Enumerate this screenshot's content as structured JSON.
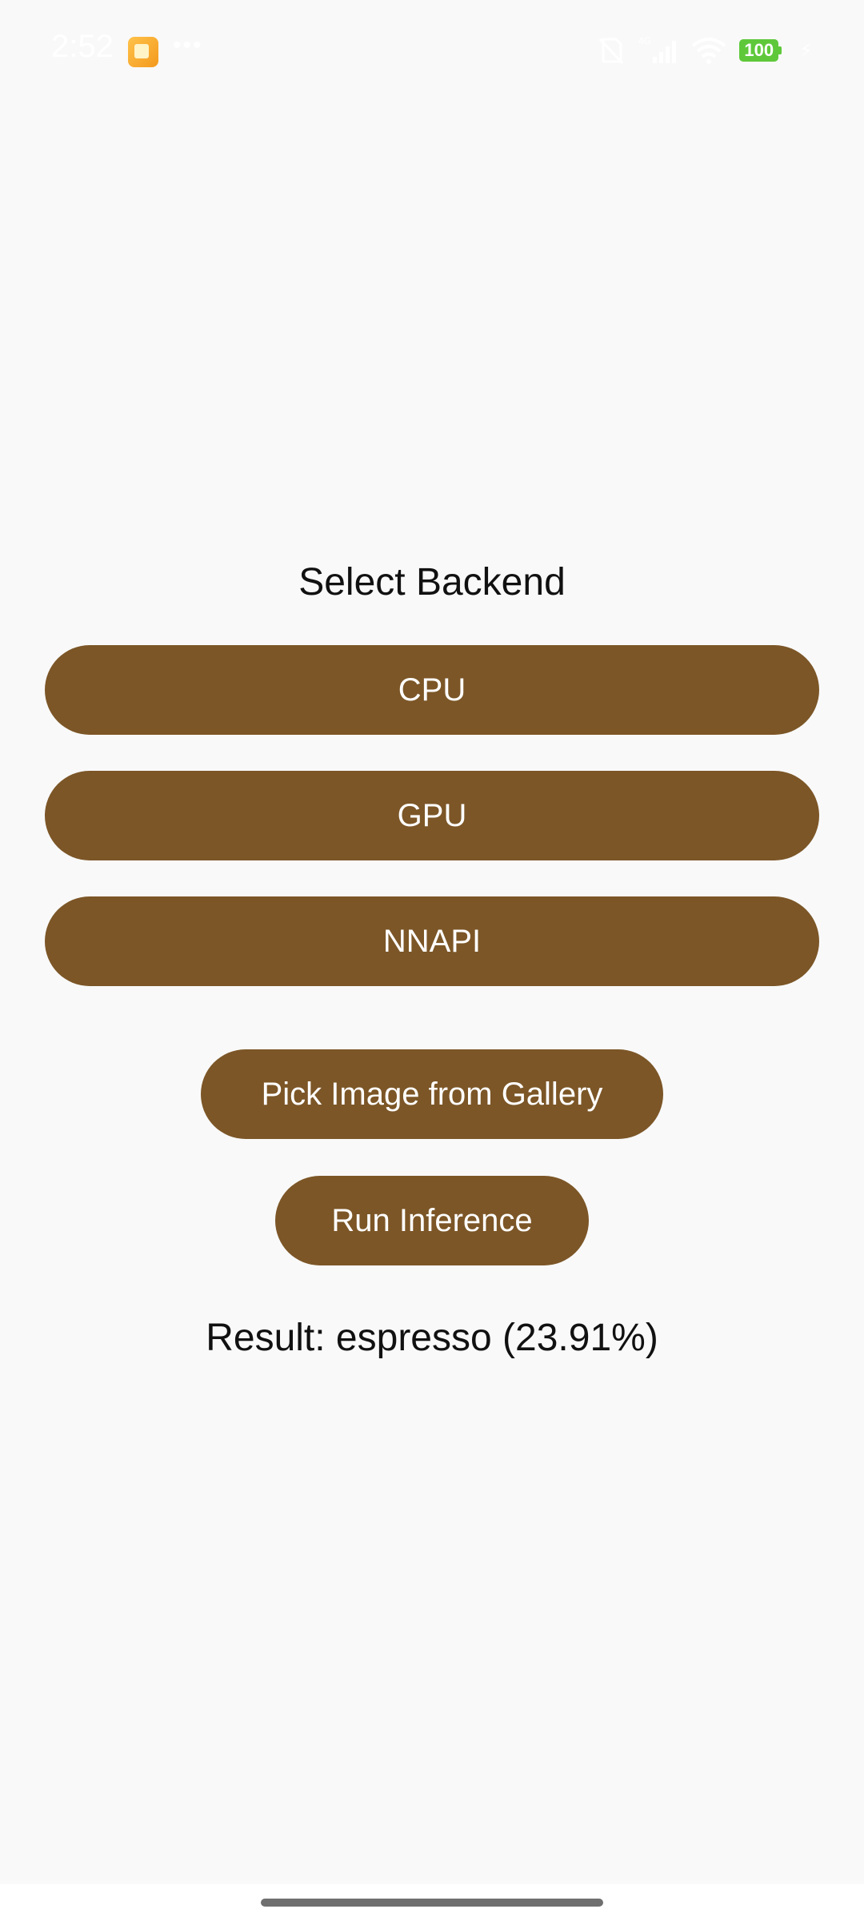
{
  "status_bar": {
    "time": "2:52",
    "network_label": "4G",
    "battery": "100"
  },
  "main": {
    "title": "Select Backend",
    "backends": [
      {
        "label": "CPU"
      },
      {
        "label": "GPU"
      },
      {
        "label": "NNAPI"
      }
    ],
    "pick_image_label": "Pick Image from Gallery",
    "run_inference_label": "Run Inference",
    "result_text": "Result: espresso (23.91%)"
  },
  "colors": {
    "button_bg": "#7c5627",
    "background": "#f9f9f9",
    "text": "#111111"
  }
}
